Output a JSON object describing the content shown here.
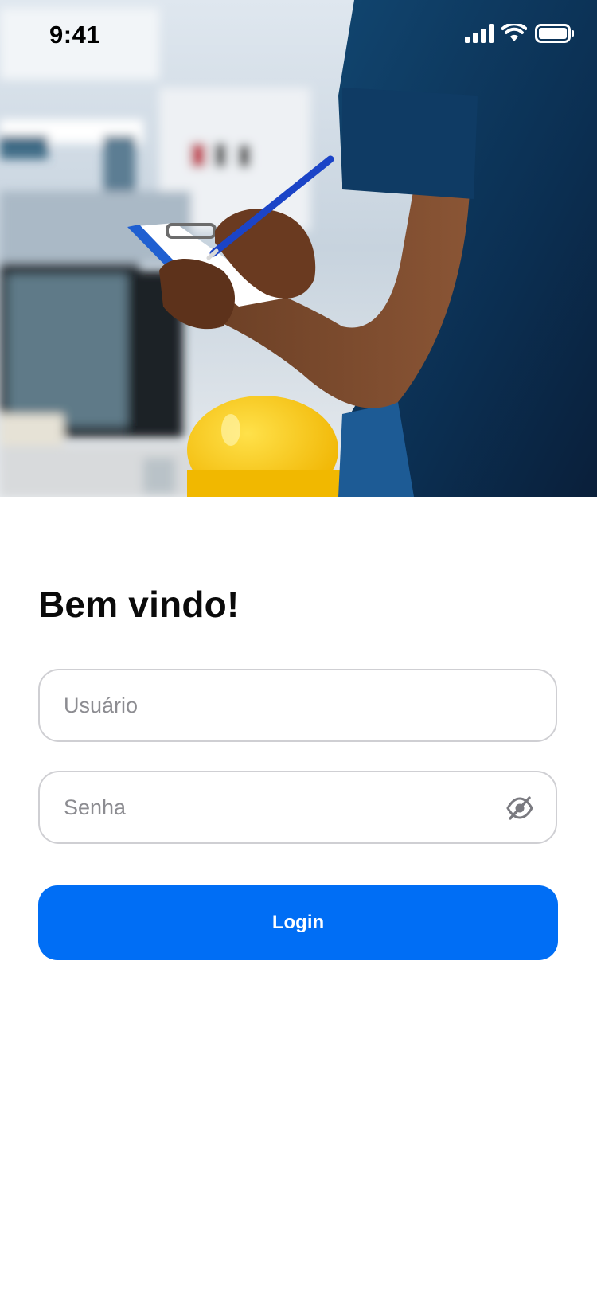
{
  "status_bar": {
    "time": "9:41",
    "icons": [
      "cellular-signal-icon",
      "wifi-icon",
      "battery-icon"
    ]
  },
  "hero": {
    "icon": "worker-clipboard-photo"
  },
  "login": {
    "title": "Bem vindo!",
    "username_placeholder": "Usuário",
    "username_value": "",
    "password_placeholder": "Senha",
    "password_value": "",
    "password_toggle_icon": "eye-off-icon",
    "submit_label": "Login"
  },
  "colors": {
    "primary": "#006ef5",
    "field_border": "#cfcfd3",
    "placeholder": "#8c8c91",
    "title": "#0a0a0a"
  }
}
